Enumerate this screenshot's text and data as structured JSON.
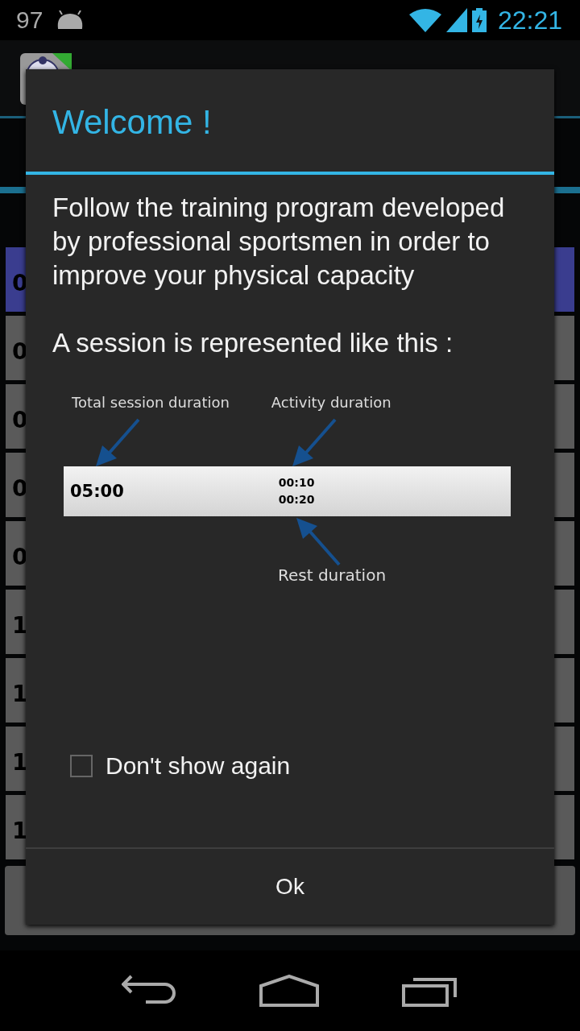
{
  "status_bar": {
    "notification_count": "97",
    "time": "22:21"
  },
  "background_list": [
    {
      "label": "0",
      "selected": true
    },
    {
      "label": "0",
      "selected": false
    },
    {
      "label": "0",
      "selected": false
    },
    {
      "label": "0",
      "selected": false
    },
    {
      "label": "0",
      "selected": false
    },
    {
      "label": "1",
      "selected": false
    },
    {
      "label": "1",
      "selected": false
    },
    {
      "label": "1",
      "selected": false
    },
    {
      "label": "1",
      "selected": false
    }
  ],
  "dialog": {
    "title": "Welcome !",
    "message": "Follow the training program developed by professional sportsmen in order to improve your physical capacity",
    "subtitle": "A session is represented like this :",
    "diagram": {
      "total_label": "Total session duration",
      "activity_label": "Activity duration",
      "rest_label": "Rest duration",
      "total": "05:00",
      "activity": "00:10",
      "rest": "00:20"
    },
    "checkbox": {
      "label": "Don't show again",
      "checked": false
    },
    "button": "Ok"
  }
}
